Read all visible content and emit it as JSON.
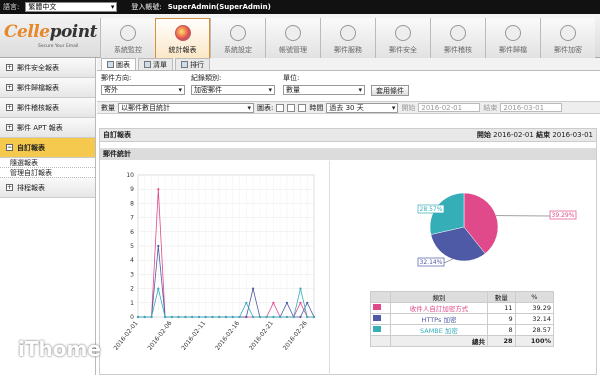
{
  "topbar": {
    "lang_label": "語言:",
    "lang_value": "繁體中文",
    "login_label": "登入帳號:",
    "login_user": "SuperAdmin(SuperAdmin)"
  },
  "logo": {
    "main1": "Celle",
    "main2": "point",
    "tagline": "Secure Your Email"
  },
  "nav": [
    {
      "label": "系統監控",
      "icon": "monitor-icon"
    },
    {
      "label": "統計報表",
      "icon": "report-pie-icon",
      "active": true
    },
    {
      "label": "系統設定",
      "icon": "settings-icon"
    },
    {
      "label": "帳號管理",
      "icon": "account-icon"
    },
    {
      "label": "郵件服務",
      "icon": "mail-service-icon"
    },
    {
      "label": "郵件安全",
      "icon": "mail-security-icon"
    },
    {
      "label": "郵件稽核",
      "icon": "mail-audit-icon"
    },
    {
      "label": "郵件歸檔",
      "icon": "mail-archive-icon"
    },
    {
      "label": "郵件加密",
      "icon": "mail-encrypt-icon"
    }
  ],
  "sidebar": [
    {
      "label": "郵件安全報表"
    },
    {
      "label": "郵件歸檔報表"
    },
    {
      "label": "郵件稽核報表"
    },
    {
      "label": "郵件 APT 報表"
    },
    {
      "label": "自訂報表",
      "active": true
    }
  ],
  "sidebar_sub": [
    "隨選報表",
    "管理自訂報表"
  ],
  "sidebar_last": {
    "label": "排程報表"
  },
  "subtabs": [
    "圖表",
    "清單",
    "排行"
  ],
  "filters": {
    "direction_label": "郵件方向:",
    "direction_value": "寄外",
    "category_label": "紀錄類別:",
    "category_value": "加密郵件",
    "unit_label": "單位:",
    "unit_value": "數量",
    "apply": "套用條件"
  },
  "toolbar": {
    "qty_label": "數量",
    "qty_value": "以郵件數目統計",
    "chart_label": "圖表:",
    "time_label": "時間",
    "time_value": "過去 30 天",
    "start_label": "開始",
    "start_value": "2016-02-01",
    "end_label": "結束",
    "end_value": "2016-03-01"
  },
  "panel": {
    "title": "自訂報表",
    "start_label": "開始",
    "start": "2016-02-01",
    "end_label": "結束",
    "end": "2016-03-01",
    "section": "郵件統計"
  },
  "legend_table": {
    "headers": [
      "類別",
      "數量",
      "%"
    ],
    "rows": [
      {
        "name": "收件人自訂加密方式",
        "count": "11",
        "pct": "39.29",
        "color": "#e04a8a"
      },
      {
        "name": "HTTPs 加密",
        "count": "9",
        "pct": "32.14",
        "color": "#4f5aa6"
      },
      {
        "name": "SAMBE 加密",
        "count": "8",
        "pct": "28.57",
        "color": "#35aeb8"
      }
    ],
    "total_label": "總共",
    "total_count": "28",
    "total_pct": "100%"
  },
  "watermark": "iThome",
  "chart_data": [
    {
      "type": "line",
      "ylim": [
        0,
        10
      ],
      "yticks": [
        0,
        1,
        2,
        3,
        4,
        5,
        6,
        7,
        8,
        9,
        10
      ],
      "x": [
        "2016-02-01",
        "2016-02-02",
        "2016-02-03",
        "2016-02-04",
        "2016-02-05",
        "2016-02-06",
        "2016-02-07",
        "2016-02-08",
        "2016-02-09",
        "2016-02-10",
        "2016-02-11",
        "2016-02-12",
        "2016-02-13",
        "2016-02-14",
        "2016-02-15",
        "2016-02-16",
        "2016-02-17",
        "2016-02-18",
        "2016-02-19",
        "2016-02-20",
        "2016-02-21",
        "2016-02-22",
        "2016-02-23",
        "2016-02-24",
        "2016-02-25",
        "2016-02-26",
        "2016-02-27"
      ],
      "xtick_labels": [
        "2016-02-01",
        "2016-02-06",
        "2016-02-11",
        "2016-02-16",
        "2016-02-21",
        "2016-02-26"
      ],
      "series": [
        {
          "color": "#e04a8a",
          "values": [
            0,
            0,
            0,
            9,
            0,
            0,
            0,
            0,
            0,
            0,
            0,
            0,
            0,
            0,
            0,
            0,
            0,
            0,
            0,
            0,
            1,
            0,
            0,
            0,
            1,
            0,
            0
          ]
        },
        {
          "color": "#4f5aa6",
          "values": [
            0,
            0,
            0,
            5,
            0,
            0,
            0,
            0,
            0,
            0,
            0,
            0,
            0,
            0,
            0,
            0,
            0,
            2,
            0,
            0,
            0,
            0,
            1,
            0,
            0,
            1,
            0
          ]
        },
        {
          "color": "#35aeb8",
          "values": [
            0,
            0,
            0,
            2,
            0,
            0,
            0,
            0,
            0,
            0,
            0,
            0,
            0,
            0,
            0,
            0,
            1,
            0,
            0,
            0,
            0,
            0,
            0,
            0,
            2,
            0,
            0
          ]
        }
      ]
    },
    {
      "type": "pie",
      "categories": [
        "收件人自訂加密方式",
        "HTTPs 加密",
        "SAMBE 加密"
      ],
      "values": [
        39.29,
        32.14,
        28.57
      ],
      "labels": [
        "39.29%",
        "32.14%",
        "28.57%"
      ],
      "colors": [
        "#e04a8a",
        "#4f5aa6",
        "#35aeb8"
      ]
    }
  ]
}
